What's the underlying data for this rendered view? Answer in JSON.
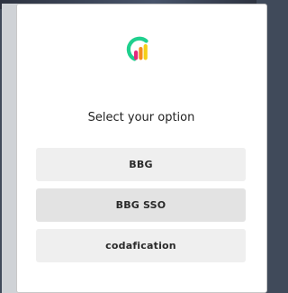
{
  "dialog": {
    "logo_icon": "gradient-bar-chart-logo-icon",
    "title": "Select your option",
    "options": [
      {
        "label": "BBG"
      },
      {
        "label": "BBG SSO"
      },
      {
        "label": "codafication"
      }
    ]
  },
  "colors": {
    "page_background": "#404a5a",
    "dialog_background": "#ffffff",
    "option_background": "#efefef",
    "option_hover_background": "#e3e3e3",
    "logo_green": "#1fd08e",
    "logo_pink": "#e5297c",
    "logo_orange": "#f48c1e",
    "logo_yellow": "#f5d017"
  }
}
